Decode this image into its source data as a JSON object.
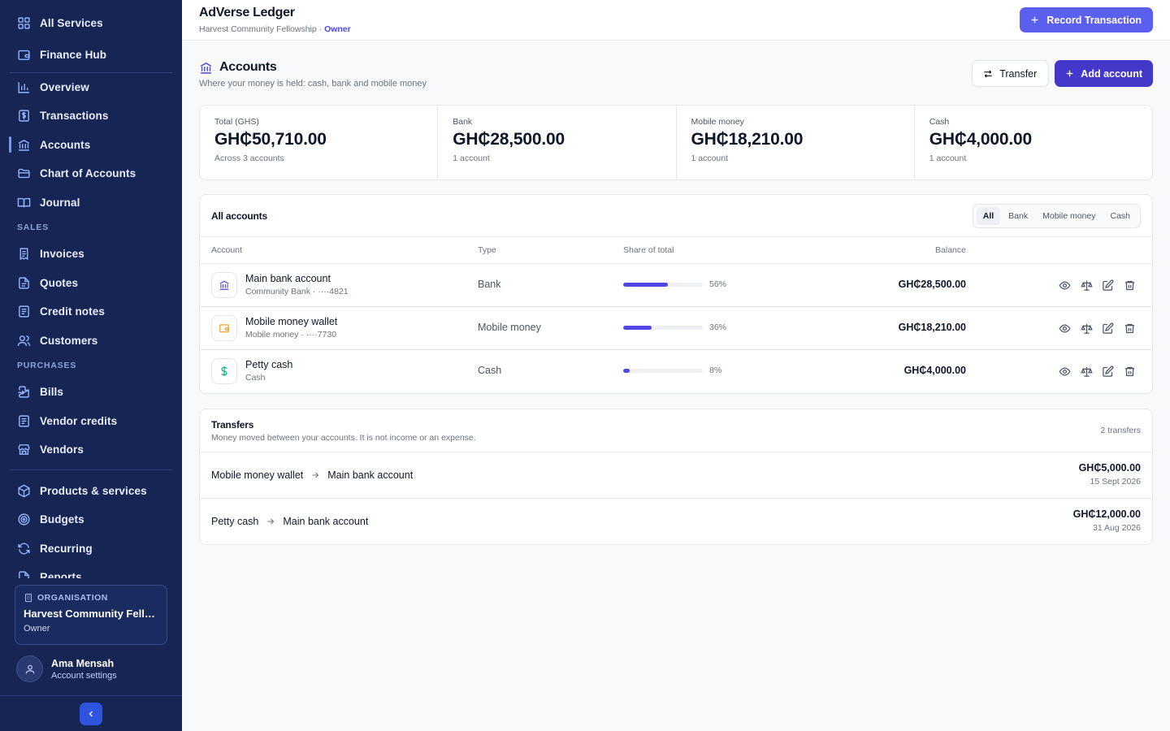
{
  "sidebar": {
    "items": [
      {
        "label": "All Services",
        "icon": "grid-icon"
      },
      {
        "label": "Finance Hub",
        "icon": "wallet-icon"
      },
      {
        "label": "Overview",
        "icon": "bar-chart-icon"
      },
      {
        "label": "Transactions",
        "icon": "dollar-doc-icon"
      },
      {
        "label": "Accounts",
        "icon": "bank-icon"
      },
      {
        "label": "Chart of Accounts",
        "icon": "folder-icon"
      },
      {
        "label": "Journal",
        "icon": "book-icon"
      },
      {
        "label": "Invoices",
        "icon": "receipt-icon"
      },
      {
        "label": "Quotes",
        "icon": "document-icon"
      },
      {
        "label": "Credit notes",
        "icon": "notes-icon"
      },
      {
        "label": "Customers",
        "icon": "users-icon"
      },
      {
        "label": "Bills",
        "icon": "file-import-icon"
      },
      {
        "label": "Vendor credits",
        "icon": "notes-icon"
      },
      {
        "label": "Vendors",
        "icon": "store-icon"
      },
      {
        "label": "Products & services",
        "icon": "box-icon"
      },
      {
        "label": "Budgets",
        "icon": "target-icon"
      },
      {
        "label": "Recurring",
        "icon": "refresh-icon"
      },
      {
        "label": "Reports",
        "icon": "report-icon"
      }
    ],
    "sections": {
      "sales": "SALES",
      "purchases": "PURCHASES"
    },
    "org": {
      "label": "ORGANISATION",
      "name": "Harvest Community Fello...",
      "role": "Owner"
    },
    "user": {
      "name": "Ama Mensah",
      "sub": "Account settings"
    }
  },
  "topbar": {
    "title": "AdVerse Ledger",
    "org": "Harvest Community Fellowship",
    "separator": " · ",
    "role": "Owner",
    "record_label": "Record Transaction"
  },
  "page": {
    "title": "Accounts",
    "subtitle": "Where your money is held: cash, bank and mobile money",
    "transfer_label": "Transfer",
    "add_label": "Add account"
  },
  "stats": [
    {
      "label": "Total (GHS)",
      "value": "GH₵50,710.00",
      "sub": "Across 3 accounts"
    },
    {
      "label": "Bank",
      "value": "GH₵28,500.00",
      "sub": "1 account"
    },
    {
      "label": "Mobile money",
      "value": "GH₵18,210.00",
      "sub": "1 account"
    },
    {
      "label": "Cash",
      "value": "GH₵4,000.00",
      "sub": "1 account"
    }
  ],
  "accounts": {
    "title": "All accounts",
    "filters": [
      "All",
      "Bank",
      "Mobile money",
      "Cash"
    ],
    "active_filter": "All",
    "headers": {
      "account": "Account",
      "type": "Type",
      "share": "Share of total",
      "balance": "Balance"
    },
    "rows": [
      {
        "name": "Main bank account",
        "sub": "Community Bank · ····4821",
        "type": "Bank",
        "share": 56,
        "share_label": "56%",
        "balance": "GH₵28,500.00",
        "icon": "bank-icon",
        "color": "#4f46e5"
      },
      {
        "name": "Mobile money wallet",
        "sub": "Mobile money · ····7730",
        "type": "Mobile money",
        "share": 36,
        "share_label": "36%",
        "balance": "GH₵18,210.00",
        "icon": "wallet-icon",
        "color": "#f59e0b"
      },
      {
        "name": "Petty cash",
        "sub": "Cash",
        "type": "Cash",
        "share": 8,
        "share_label": "8%",
        "balance": "GH₵4,000.00",
        "icon": "dollar-icon",
        "color": "#10b981"
      }
    ]
  },
  "transfers": {
    "title": "Transfers",
    "subtitle": "Money moved between your accounts. It is not income or an expense.",
    "count": "2 transfers",
    "rows": [
      {
        "from": "Mobile money wallet",
        "to": "Main bank account",
        "amount": "GH₵5,000.00",
        "date": "15 Sept 2026"
      },
      {
        "from": "Petty cash",
        "to": "Main bank account",
        "amount": "GH₵12,000.00",
        "date": "31 Aug 2026"
      }
    ]
  },
  "colors": {
    "sidebar_bg": "#172554",
    "accent": "#4f46e5",
    "primary_button": "#5b5fef"
  }
}
